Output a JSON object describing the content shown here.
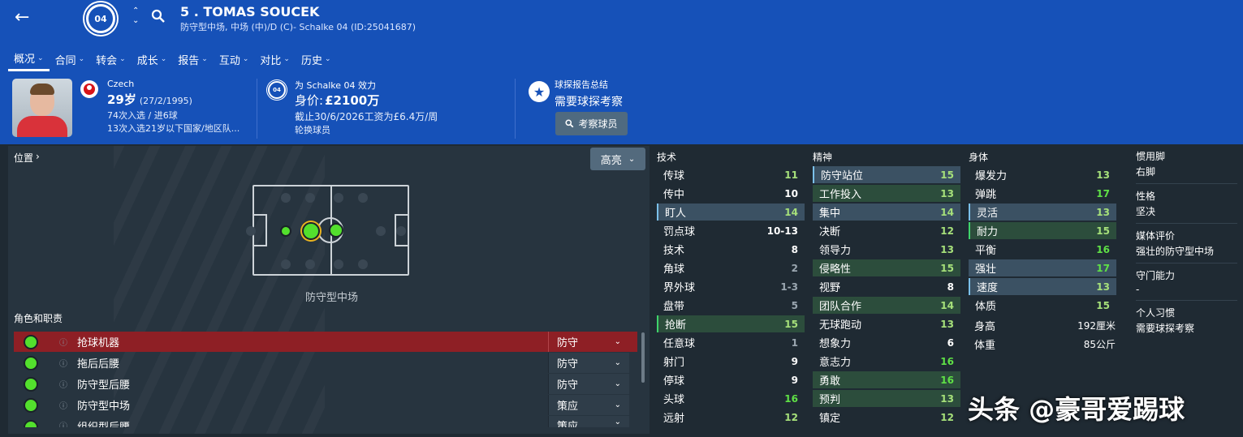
{
  "header": {
    "title": "5 . TOMAS SOUCEK",
    "subtitle": "防守型中场, 中场 (中)/D (C)- Schalke 04 (ID:25041687)",
    "club_crest_text": "04",
    "tabs": [
      {
        "label": "概况"
      },
      {
        "label": "合同"
      },
      {
        "label": "转会"
      },
      {
        "label": "成长"
      },
      {
        "label": "报告"
      },
      {
        "label": "互动"
      },
      {
        "label": "对比"
      },
      {
        "label": "历史"
      }
    ]
  },
  "info": {
    "nation": "Czech",
    "age": "29岁",
    "dob": "(27/2/1995)",
    "caps": "74次入选 / 进6球",
    "youth_caps": "13次入选21岁以下国家/地区队...",
    "plays_for": "为 Schalke 04 效力",
    "value_label": "身价:",
    "value": "£2100万",
    "contract": "截止30/6/2026工资为£6.4万/周",
    "status": "轮换球员",
    "scout_title": "球探报告总结",
    "scout_needed": "需要球探考察",
    "scout_button": "考察球员"
  },
  "left": {
    "positions_label": "位置",
    "highlight_button": "高亮",
    "position_name": "防守型中场",
    "roles_header": "角色和职责",
    "roles": [
      {
        "name": "抢球机器",
        "duty": "防守"
      },
      {
        "name": "拖后后腰",
        "duty": "防守"
      },
      {
        "name": "防守型后腰",
        "duty": "防守"
      },
      {
        "name": "防守型中场",
        "duty": "策应"
      },
      {
        "name": "组织型后腰",
        "duty": "策应"
      }
    ]
  },
  "attributes": {
    "technical_header": "技术",
    "mental_header": "精神",
    "physical_header": "身体",
    "technical": [
      {
        "name": "传球",
        "value": "11"
      },
      {
        "name": "传中",
        "value": "10"
      },
      {
        "name": "盯人",
        "value": "14"
      },
      {
        "name": "罚点球",
        "value": "10-13"
      },
      {
        "name": "技术",
        "value": "8"
      },
      {
        "name": "角球",
        "value": "2"
      },
      {
        "name": "界外球",
        "value": "1-3"
      },
      {
        "name": "盘带",
        "value": "5"
      },
      {
        "name": "抢断",
        "value": "15"
      },
      {
        "name": "任意球",
        "value": "1"
      },
      {
        "name": "射门",
        "value": "9"
      },
      {
        "name": "停球",
        "value": "9"
      },
      {
        "name": "头球",
        "value": "16"
      },
      {
        "name": "远射",
        "value": "12"
      }
    ],
    "mental": [
      {
        "name": "防守站位",
        "value": "15"
      },
      {
        "name": "工作投入",
        "value": "13"
      },
      {
        "name": "集中",
        "value": "14"
      },
      {
        "name": "决断",
        "value": "12"
      },
      {
        "name": "领导力",
        "value": "13"
      },
      {
        "name": "侵略性",
        "value": "15"
      },
      {
        "name": "视野",
        "value": "8"
      },
      {
        "name": "团队合作",
        "value": "14"
      },
      {
        "name": "无球跑动",
        "value": "13"
      },
      {
        "name": "想象力",
        "value": "6"
      },
      {
        "name": "意志力",
        "value": "16"
      },
      {
        "name": "勇敢",
        "value": "16"
      },
      {
        "name": "预判",
        "value": "13"
      },
      {
        "name": "镇定",
        "value": "12"
      }
    ],
    "physical": [
      {
        "name": "爆发力",
        "value": "13"
      },
      {
        "name": "弹跳",
        "value": "17"
      },
      {
        "name": "灵活",
        "value": "13"
      },
      {
        "name": "耐力",
        "value": "15"
      },
      {
        "name": "平衡",
        "value": "16"
      },
      {
        "name": "强壮",
        "value": "17"
      },
      {
        "name": "速度",
        "value": "13"
      },
      {
        "name": "体质",
        "value": "15"
      }
    ],
    "height_label": "身高",
    "height": "192厘米",
    "weight_label": "体重",
    "weight": "85公斤"
  },
  "side": {
    "foot_label": "惯用脚",
    "foot": "右脚",
    "personality_label": "性格",
    "personality": "坚决",
    "media_label": "媒体评价",
    "media": "强壮的防守型中场",
    "gk_label": "守门能力",
    "gk": "-",
    "habits_label": "个人习惯",
    "habits": "需要球探考察"
  },
  "watermark": "头条 @豪哥爱踢球",
  "colors": {
    "header_blue": "#1651b8",
    "role_selected": "#8e1f25",
    "green_dot": "#53e02d"
  }
}
